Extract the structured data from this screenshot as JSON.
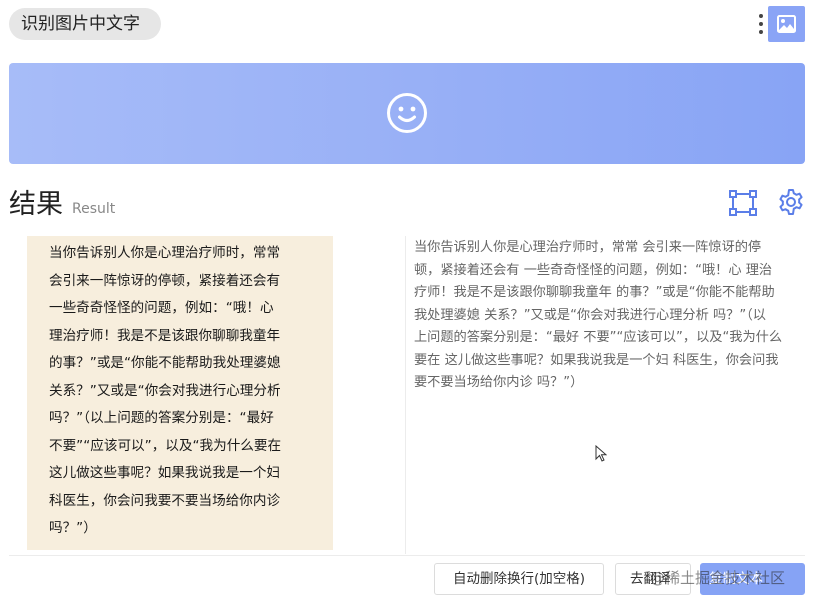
{
  "app": {
    "title": "识别图片中文字"
  },
  "toolbar": {
    "more_icon": "more-vertical-icon",
    "image_icon": "image-icon"
  },
  "banner": {
    "icon": "smiley-face-icon"
  },
  "result": {
    "title": "结果",
    "subtitle": "Result",
    "crop_icon": "crop-frame-icon",
    "settings_icon": "gear-icon"
  },
  "source_image": {
    "lines": [
      "当你告诉别人你是心理治疗师时，常常",
      "会引来一阵惊讶的停顿，紧接着还会有",
      "一些奇奇怪怪的问题，例如：“哦！心",
      "理治疗师！我是不是该跟你聊聊我童年",
      "的事？”或是“你能不能帮助我处理婆媳",
      "关系？”又或是“你会对我进行心理分析",
      "吗？”（以上问题的答案分别是：“最好",
      "不要”“应该可以”，以及“我为什么要在",
      "这儿做这些事呢？如果我说我是一个妇",
      "科医生，你会问我要不要当场给你内诊",
      "吗？”）"
    ]
  },
  "recognized_text": {
    "lines": [
      "当你告诉别人你是心理治疗师时，常常 会引来一阵惊讶的停",
      "顿，紧接着还会有 一些奇奇怪怪的问题，例如：“哦！心 理治",
      "疗师！我是不是该跟你聊聊我童年 的事？”或是“你能不能帮助",
      "我处理婆媳 关系？”又或是“你会对我进行心理分析 吗？”（以",
      "上问题的答案分别是：“最好 不要”“应该可以”，以及“我为什么",
      "要在 这儿做这些事呢？如果我说我是一个妇 科医生，你会问我",
      "要不要当场给你内诊 吗？”）"
    ]
  },
  "actions": {
    "remove_linebreaks": "自动删除换行(加空格)",
    "dedup": "去翻译",
    "copy": "复制文本"
  },
  "watermark": "@稀土掘金技术社区",
  "colors": {
    "accent": "#86a3f5",
    "banner_start": "#a7bcf8",
    "banner_end": "#88a4f5",
    "image_bg": "#f7eedd"
  }
}
